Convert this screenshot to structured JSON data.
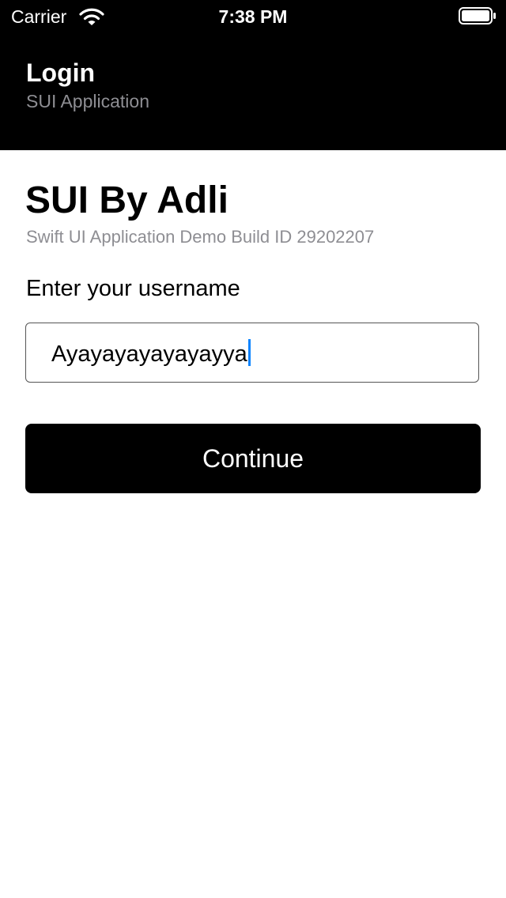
{
  "status_bar": {
    "carrier": "Carrier",
    "time": "7:38 PM",
    "wifi_icon": "wifi-icon",
    "battery_icon": "battery-icon"
  },
  "nav": {
    "title": "Login",
    "subtitle": "SUI Application"
  },
  "main": {
    "title": "SUI By Adli",
    "subtitle": "Swift UI Application Demo Build ID 29202207",
    "username_label": "Enter your username",
    "username_value": "Ayayayayayayayya",
    "continue_label": "Continue"
  },
  "colors": {
    "header_background": "#000000",
    "secondary_text": "#8e8e93",
    "caret": "#0a84ff",
    "button_background": "#000000"
  }
}
